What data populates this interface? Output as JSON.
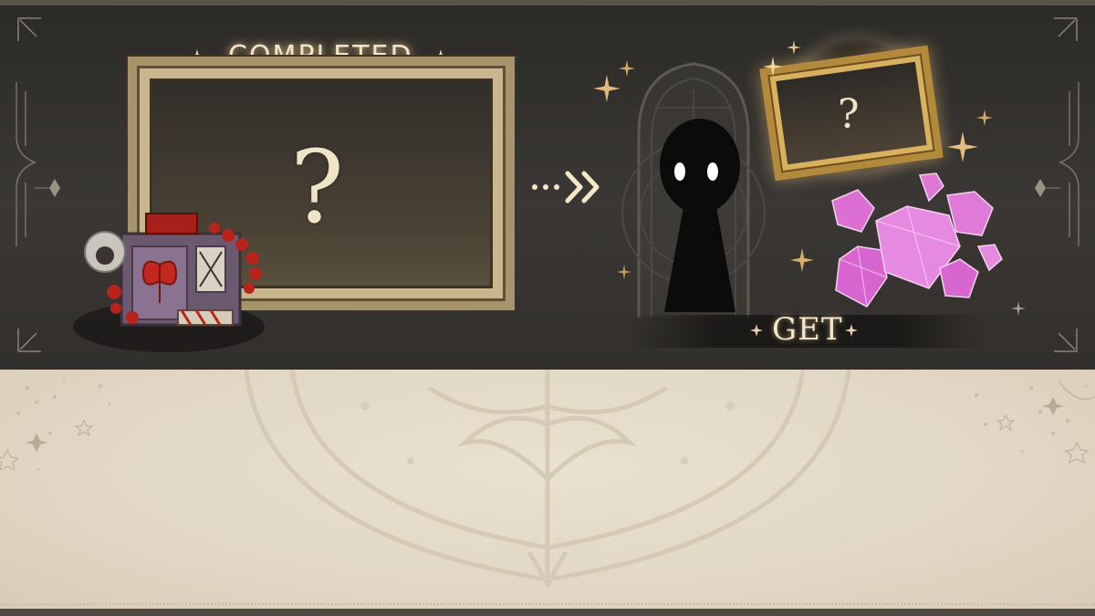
{
  "banner": {
    "completed_label": "COMPLETED",
    "get_label": "GET"
  },
  "left_frame": {
    "placeholder_glyph": "?"
  },
  "right_frame": {
    "placeholder_glyph": "?"
  },
  "icons": {
    "arrow": "double-chevron-right-icon",
    "avatar": "silhouette-avatar-icon",
    "gems": "pink-gem-icon",
    "sparkle": "sparkle-icon",
    "item": "ornate-chest-icon"
  },
  "colors": {
    "banner_bg": "#3a3734",
    "lower_bg": "#e6ddcc",
    "gold": "#b38a3c",
    "label_text": "#f3e6c8",
    "gem_pink": "#e07ad8"
  }
}
